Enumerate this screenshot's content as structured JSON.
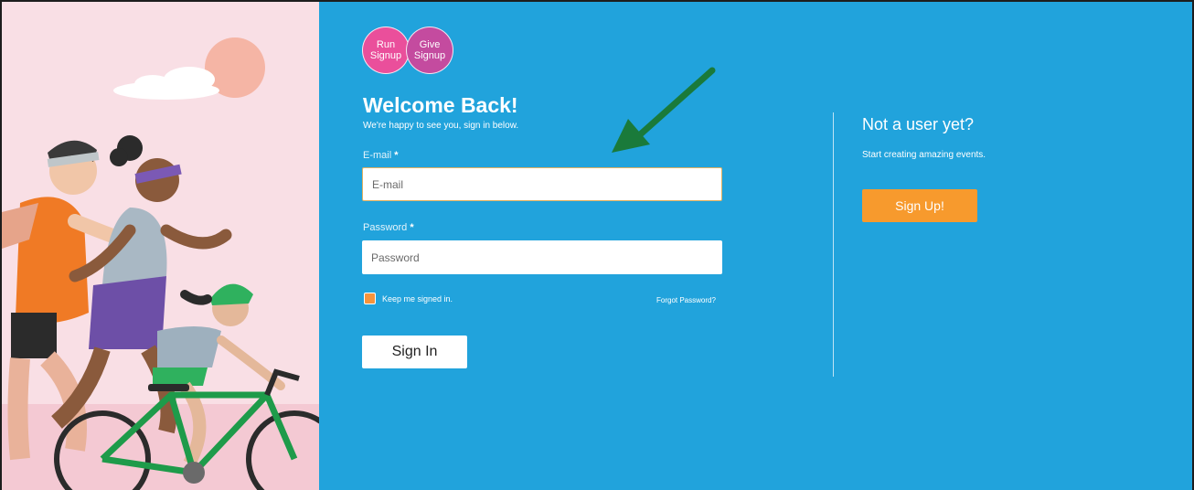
{
  "logo": {
    "run_line1": "Run",
    "run_line2": "Signup",
    "give_line1": "Give",
    "give_line2": "Signup"
  },
  "login": {
    "title": "Welcome Back!",
    "subtitle": "We're happy to see you, sign in below.",
    "email_label": "E-mail",
    "email_placeholder": "E-mail",
    "password_label": "Password",
    "password_placeholder": "Password",
    "required_mark": "*",
    "keep_signed_in_label": "Keep me signed in.",
    "keep_signed_in_checked": true,
    "forgot_password": "Forgot Password?",
    "sign_in_button": "Sign In"
  },
  "signup": {
    "title": "Not a user yet?",
    "subtitle": "Start creating amazing events.",
    "button": "Sign Up!"
  },
  "colors": {
    "panel_bg": "#21a3dc",
    "illustration_bg": "#f9dfe5",
    "signup_button": "#f79a2d",
    "checkbox": "#f7943b",
    "annotation_arrow": "#1a7a3a"
  },
  "icons": {
    "annotation": "arrow-annotation-icon",
    "illustration": "runners-cyclist-illustration"
  }
}
